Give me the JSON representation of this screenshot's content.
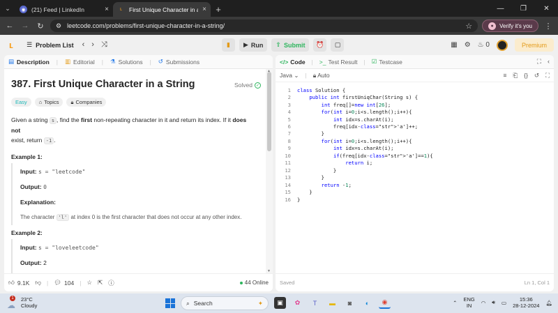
{
  "browser": {
    "tabs": [
      {
        "title": "(21) Feed | LinkedIn",
        "active": false
      },
      {
        "title": "First Unique Character in a Strin",
        "active": true
      }
    ],
    "url": "leetcode.com/problems/first-unique-character-in-a-string/",
    "verify_label": "Verify it's you"
  },
  "lc_nav": {
    "problem_list": "Problem List",
    "run": "Run",
    "submit": "Submit",
    "streak": "0",
    "premium": "Premium"
  },
  "left": {
    "tabs": [
      "Description",
      "Editorial",
      "Solutions",
      "Submissions"
    ],
    "title": "387. First Unique Character in a String",
    "solved": "Solved",
    "tags": [
      "Easy",
      "Topics",
      "Companies"
    ],
    "desc": {
      "p1": "Given a string ",
      "s": "s",
      "p2": ", find the ",
      "first": "first",
      "p3": " non-repeating character in it and return its index. If it ",
      "doesnot": "does not",
      "p4": "exist, return ",
      "neg": "-1",
      "p5": "."
    },
    "example1": {
      "title": "Example 1:",
      "input_label": "Input:",
      "input_val": "s = \"leetcode\"",
      "output_label": "Output:",
      "output_val": "0",
      "expl_label": "Explanation:",
      "expl_pre": "The character ",
      "expl_char": "'l'",
      "expl_post": " at index 0 is the first character that does not occur at any other index."
    },
    "example2": {
      "title": "Example 2:",
      "input_label": "Input:",
      "input_val": "s = \"loveleetcode\"",
      "output_label": "Output:",
      "output_val": "2"
    },
    "footer": {
      "likes": "9.1K",
      "comments": "104",
      "online": "44 Online"
    }
  },
  "right": {
    "tabs": [
      "Code",
      "Test Result",
      "Testcase"
    ],
    "language": "Java",
    "auto": "Auto",
    "code_lines": [
      "class Solution {",
      "    public int firstUniqChar(String s) {",
      "        int freq[]=new int[26];",
      "        for(int i=0;i<s.length();i++){",
      "            int idx=s.charAt(i);",
      "            freq[idx-'a']++;",
      "        }",
      "        for(int i=0;i<s.length();i++){",
      "            int idx=s.charAt(i);",
      "            if(freq[idx-'a']==1){",
      "                return i;",
      "            }",
      "        }",
      "        return -1;",
      "    }",
      "}"
    ],
    "saved": "Saved",
    "position": "Ln 1, Col 1"
  },
  "taskbar": {
    "weather_temp": "23°C",
    "weather_desc": "Cloudy",
    "notif_count": "1",
    "search_placeholder": "Search",
    "lang_top": "ENG",
    "lang_bottom": "IN",
    "time": "15:36",
    "date": "28-12-2024"
  }
}
